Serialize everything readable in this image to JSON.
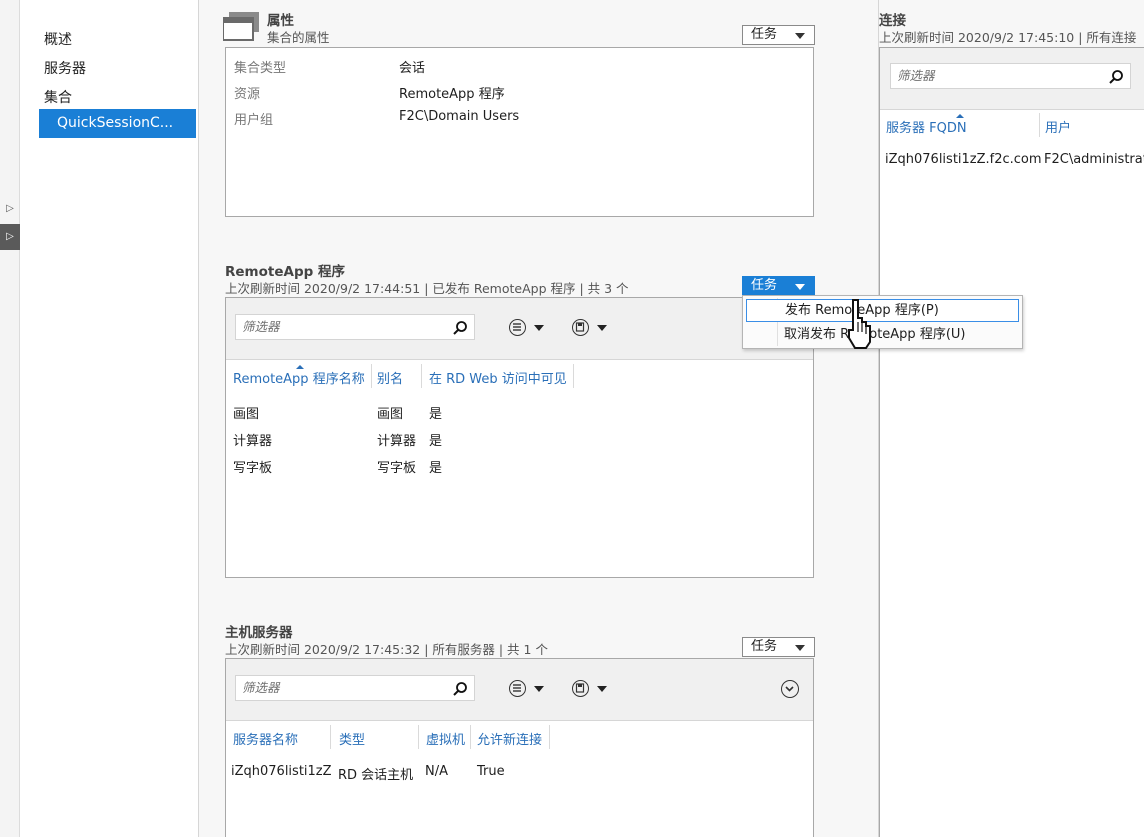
{
  "nav": {
    "items": [
      "概述",
      "服务器",
      "集合"
    ],
    "selected": "QuickSessionC..."
  },
  "properties": {
    "title": "属性",
    "subtitle": "集合的属性",
    "task_label": "任务",
    "rows": [
      {
        "label": "集合类型",
        "value": "会话"
      },
      {
        "label": "资源",
        "value": "RemoteApp 程序"
      },
      {
        "label": "用户组",
        "value": "F2C\\Domain Users"
      }
    ]
  },
  "remoteapp": {
    "title": "RemoteApp 程序",
    "subtitle": "上次刷新时间 2020/9/2 17:44:51 | 已发布 RemoteApp 程序 | 共 3 个",
    "task_label": "任务",
    "filter_placeholder": "筛选器",
    "columns": [
      "RemoteApp 程序名称",
      "别名",
      "在 RD Web 访问中可见"
    ],
    "rows": [
      [
        "画图",
        "画图",
        "是"
      ],
      [
        "计算器",
        "计算器",
        "是"
      ],
      [
        "写字板",
        "写字板",
        "是"
      ]
    ]
  },
  "task_menu": {
    "items": [
      "发布 RemoteApp 程序(P)",
      "取消发布 RemoteApp 程序(U)"
    ],
    "highlighted_index": 0
  },
  "host_servers": {
    "title": "主机服务器",
    "subtitle": "上次刷新时间 2020/9/2 17:45:32 | 所有服务器 | 共 1 个",
    "task_label": "任务",
    "filter_placeholder": "筛选器",
    "columns": [
      "服务器名称",
      "类型",
      "虚拟机",
      "允许新连接"
    ],
    "rows": [
      [
        "iZqh076listi1zZ",
        "RD 会话主机",
        "N/A",
        "True"
      ]
    ]
  },
  "connections": {
    "title": "连接",
    "subtitle": "上次刷新时间 2020/9/2 17:45:10 | 所有连接",
    "filter_placeholder": "筛选器",
    "columns": [
      "服务器 FQDN",
      "用户"
    ],
    "rows": [
      [
        "iZqh076listi1zZ.f2c.com",
        "F2C\\administrat"
      ]
    ]
  },
  "colors": {
    "accent": "#1a7fd6",
    "link": "#2a6fb8",
    "panel_bg": "#f7f7f7"
  }
}
